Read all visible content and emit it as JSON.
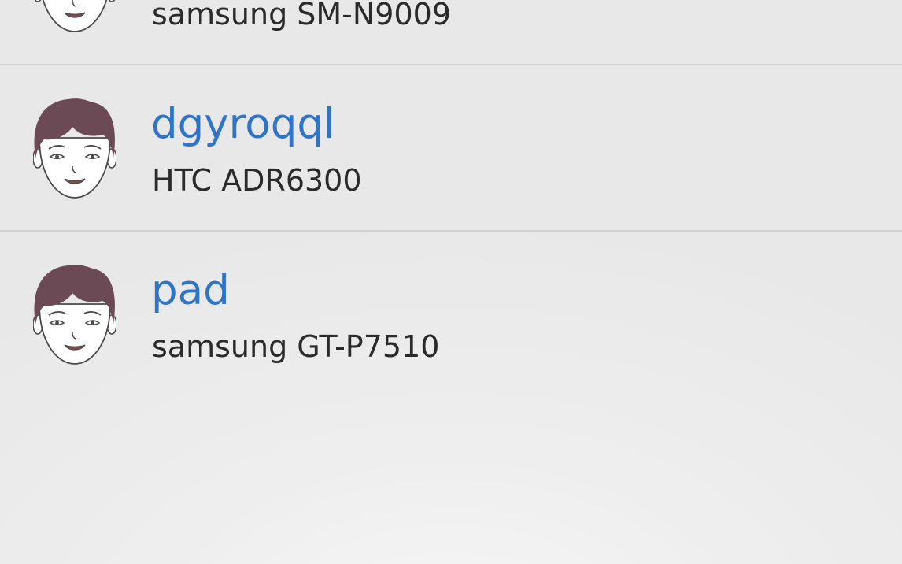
{
  "devices": [
    {
      "name": "",
      "model": "samsung SM-N9009",
      "avatar_icon": "male-face-avatar-icon"
    },
    {
      "name": "dgyroqql",
      "model": "HTC ADR6300",
      "avatar_icon": "male-face-avatar-icon"
    },
    {
      "name": "pad",
      "model": "samsung GT-P7510",
      "avatar_icon": "male-face-avatar-icon"
    }
  ],
  "colors": {
    "name_text": "#2f74c6",
    "model_text": "#2a2a2a",
    "divider": "#d2d2d2",
    "hair": "#6b4a55"
  }
}
